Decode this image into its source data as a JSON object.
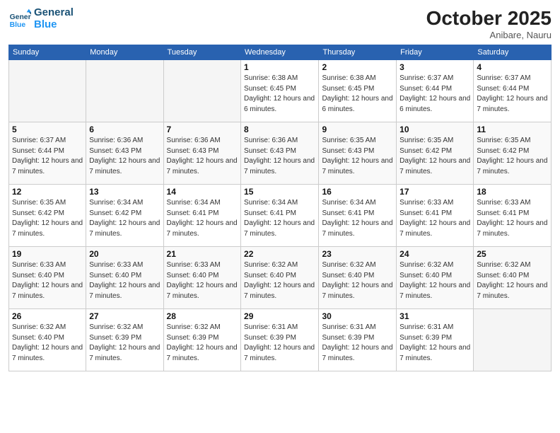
{
  "logo": {
    "line1": "General",
    "line2": "Blue"
  },
  "title": "October 2025",
  "location": "Anibare, Nauru",
  "days_header": [
    "Sunday",
    "Monday",
    "Tuesday",
    "Wednesday",
    "Thursday",
    "Friday",
    "Saturday"
  ],
  "weeks": [
    [
      {
        "day": "",
        "empty": true
      },
      {
        "day": "",
        "empty": true
      },
      {
        "day": "",
        "empty": true
      },
      {
        "day": "1",
        "sunrise": "Sunrise: 6:38 AM",
        "sunset": "Sunset: 6:45 PM",
        "daylight": "Daylight: 12 hours and 6 minutes."
      },
      {
        "day": "2",
        "sunrise": "Sunrise: 6:38 AM",
        "sunset": "Sunset: 6:45 PM",
        "daylight": "Daylight: 12 hours and 6 minutes."
      },
      {
        "day": "3",
        "sunrise": "Sunrise: 6:37 AM",
        "sunset": "Sunset: 6:44 PM",
        "daylight": "Daylight: 12 hours and 6 minutes."
      },
      {
        "day": "4",
        "sunrise": "Sunrise: 6:37 AM",
        "sunset": "Sunset: 6:44 PM",
        "daylight": "Daylight: 12 hours and 7 minutes."
      }
    ],
    [
      {
        "day": "5",
        "sunrise": "Sunrise: 6:37 AM",
        "sunset": "Sunset: 6:44 PM",
        "daylight": "Daylight: 12 hours and 7 minutes."
      },
      {
        "day": "6",
        "sunrise": "Sunrise: 6:36 AM",
        "sunset": "Sunset: 6:43 PM",
        "daylight": "Daylight: 12 hours and 7 minutes."
      },
      {
        "day": "7",
        "sunrise": "Sunrise: 6:36 AM",
        "sunset": "Sunset: 6:43 PM",
        "daylight": "Daylight: 12 hours and 7 minutes."
      },
      {
        "day": "8",
        "sunrise": "Sunrise: 6:36 AM",
        "sunset": "Sunset: 6:43 PM",
        "daylight": "Daylight: 12 hours and 7 minutes."
      },
      {
        "day": "9",
        "sunrise": "Sunrise: 6:35 AM",
        "sunset": "Sunset: 6:43 PM",
        "daylight": "Daylight: 12 hours and 7 minutes."
      },
      {
        "day": "10",
        "sunrise": "Sunrise: 6:35 AM",
        "sunset": "Sunset: 6:42 PM",
        "daylight": "Daylight: 12 hours and 7 minutes."
      },
      {
        "day": "11",
        "sunrise": "Sunrise: 6:35 AM",
        "sunset": "Sunset: 6:42 PM",
        "daylight": "Daylight: 12 hours and 7 minutes."
      }
    ],
    [
      {
        "day": "12",
        "sunrise": "Sunrise: 6:35 AM",
        "sunset": "Sunset: 6:42 PM",
        "daylight": "Daylight: 12 hours and 7 minutes."
      },
      {
        "day": "13",
        "sunrise": "Sunrise: 6:34 AM",
        "sunset": "Sunset: 6:42 PM",
        "daylight": "Daylight: 12 hours and 7 minutes."
      },
      {
        "day": "14",
        "sunrise": "Sunrise: 6:34 AM",
        "sunset": "Sunset: 6:41 PM",
        "daylight": "Daylight: 12 hours and 7 minutes."
      },
      {
        "day": "15",
        "sunrise": "Sunrise: 6:34 AM",
        "sunset": "Sunset: 6:41 PM",
        "daylight": "Daylight: 12 hours and 7 minutes."
      },
      {
        "day": "16",
        "sunrise": "Sunrise: 6:34 AM",
        "sunset": "Sunset: 6:41 PM",
        "daylight": "Daylight: 12 hours and 7 minutes."
      },
      {
        "day": "17",
        "sunrise": "Sunrise: 6:33 AM",
        "sunset": "Sunset: 6:41 PM",
        "daylight": "Daylight: 12 hours and 7 minutes."
      },
      {
        "day": "18",
        "sunrise": "Sunrise: 6:33 AM",
        "sunset": "Sunset: 6:41 PM",
        "daylight": "Daylight: 12 hours and 7 minutes."
      }
    ],
    [
      {
        "day": "19",
        "sunrise": "Sunrise: 6:33 AM",
        "sunset": "Sunset: 6:40 PM",
        "daylight": "Daylight: 12 hours and 7 minutes."
      },
      {
        "day": "20",
        "sunrise": "Sunrise: 6:33 AM",
        "sunset": "Sunset: 6:40 PM",
        "daylight": "Daylight: 12 hours and 7 minutes."
      },
      {
        "day": "21",
        "sunrise": "Sunrise: 6:33 AM",
        "sunset": "Sunset: 6:40 PM",
        "daylight": "Daylight: 12 hours and 7 minutes."
      },
      {
        "day": "22",
        "sunrise": "Sunrise: 6:32 AM",
        "sunset": "Sunset: 6:40 PM",
        "daylight": "Daylight: 12 hours and 7 minutes."
      },
      {
        "day": "23",
        "sunrise": "Sunrise: 6:32 AM",
        "sunset": "Sunset: 6:40 PM",
        "daylight": "Daylight: 12 hours and 7 minutes."
      },
      {
        "day": "24",
        "sunrise": "Sunrise: 6:32 AM",
        "sunset": "Sunset: 6:40 PM",
        "daylight": "Daylight: 12 hours and 7 minutes."
      },
      {
        "day": "25",
        "sunrise": "Sunrise: 6:32 AM",
        "sunset": "Sunset: 6:40 PM",
        "daylight": "Daylight: 12 hours and 7 minutes."
      }
    ],
    [
      {
        "day": "26",
        "sunrise": "Sunrise: 6:32 AM",
        "sunset": "Sunset: 6:40 PM",
        "daylight": "Daylight: 12 hours and 7 minutes."
      },
      {
        "day": "27",
        "sunrise": "Sunrise: 6:32 AM",
        "sunset": "Sunset: 6:39 PM",
        "daylight": "Daylight: 12 hours and 7 minutes."
      },
      {
        "day": "28",
        "sunrise": "Sunrise: 6:32 AM",
        "sunset": "Sunset: 6:39 PM",
        "daylight": "Daylight: 12 hours and 7 minutes."
      },
      {
        "day": "29",
        "sunrise": "Sunrise: 6:31 AM",
        "sunset": "Sunset: 6:39 PM",
        "daylight": "Daylight: 12 hours and 7 minutes."
      },
      {
        "day": "30",
        "sunrise": "Sunrise: 6:31 AM",
        "sunset": "Sunset: 6:39 PM",
        "daylight": "Daylight: 12 hours and 7 minutes."
      },
      {
        "day": "31",
        "sunrise": "Sunrise: 6:31 AM",
        "sunset": "Sunset: 6:39 PM",
        "daylight": "Daylight: 12 hours and 7 minutes."
      },
      {
        "day": "",
        "empty": true
      }
    ]
  ]
}
